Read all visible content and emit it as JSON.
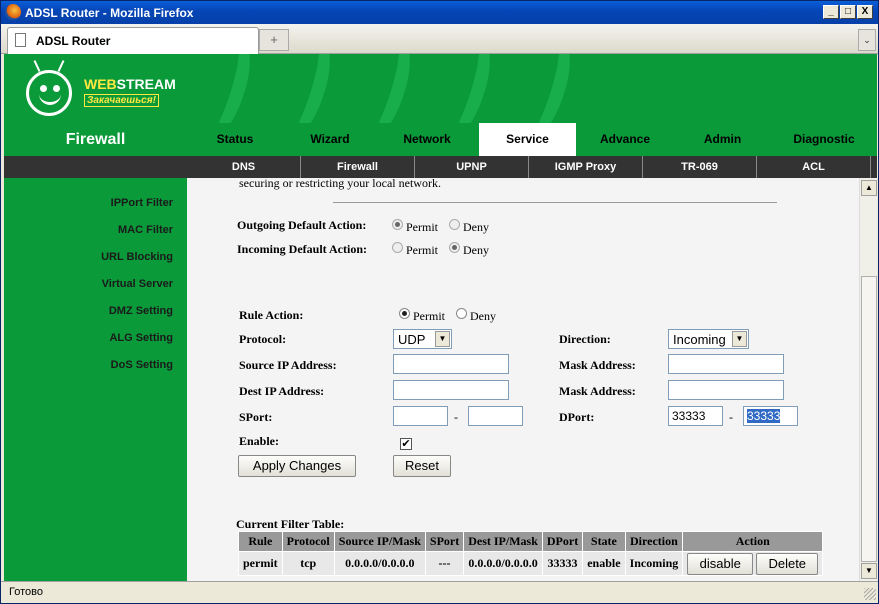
{
  "window": {
    "title": "ADSL Router - Mozilla Firefox",
    "min": "_",
    "max": "□",
    "close": "X"
  },
  "browser": {
    "tab_title": "ADSL Router",
    "new_tab": "+",
    "tab_menu": "⌄",
    "status": "Готово"
  },
  "banner": {
    "brand_a": "WEB",
    "brand_b": "STREAM",
    "tagline": "Закачаешься!"
  },
  "section_title": "Firewall",
  "menu": {
    "tabs": [
      "Status",
      "Wizard",
      "Network",
      "Service",
      "Advance",
      "Admin",
      "Diagnostic"
    ],
    "active": "Service"
  },
  "submenu": {
    "tabs": [
      "DNS",
      "Firewall",
      "UPNP",
      "IGMP Proxy",
      "TR-069",
      "ACL"
    ]
  },
  "sidebar": {
    "items": [
      "IPPort Filter",
      "MAC Filter",
      "URL Blocking",
      "Virtual Server",
      "DMZ Setting",
      "ALG Setting",
      "DoS Setting"
    ]
  },
  "form": {
    "intro_tail": "securing or restricting your local network.",
    "outgoing_label": "Outgoing Default Action:",
    "incoming_label": "Incoming Default Action:",
    "permit": "Permit",
    "deny": "Deny",
    "rule_action_label": "Rule Action:",
    "protocol_label": "Protocol:",
    "protocol_value": "UDP",
    "direction_label": "Direction:",
    "direction_value": "Incoming",
    "src_ip_label": "Source IP Address:",
    "mask_label": "Mask Address:",
    "dest_ip_label": "Dest IP Address:",
    "sport_label": "SPort:",
    "dport_label": "DPort:",
    "dash": "-",
    "dport_from": "33333",
    "dport_to": "33333",
    "enable_label": "Enable:",
    "enable_check": "✔",
    "apply_btn": "Apply Changes",
    "reset_btn": "Reset"
  },
  "table": {
    "caption": "Current Filter Table:",
    "headers": [
      "Rule",
      "Protocol",
      "Source IP/Mask",
      "SPort",
      "Dest IP/Mask",
      "DPort",
      "State",
      "Direction",
      "Action"
    ],
    "rows": [
      {
        "rule": "permit",
        "protocol": "tcp",
        "src": "0.0.0.0/0.0.0.0",
        "sport": "---",
        "dest": "0.0.0.0/0.0.0.0",
        "dport": "33333",
        "state": "enable",
        "direction": "Incoming",
        "btn1": "disable",
        "btn2": "Delete"
      }
    ]
  },
  "scroll": {
    "up": "▲",
    "down": "▼"
  }
}
